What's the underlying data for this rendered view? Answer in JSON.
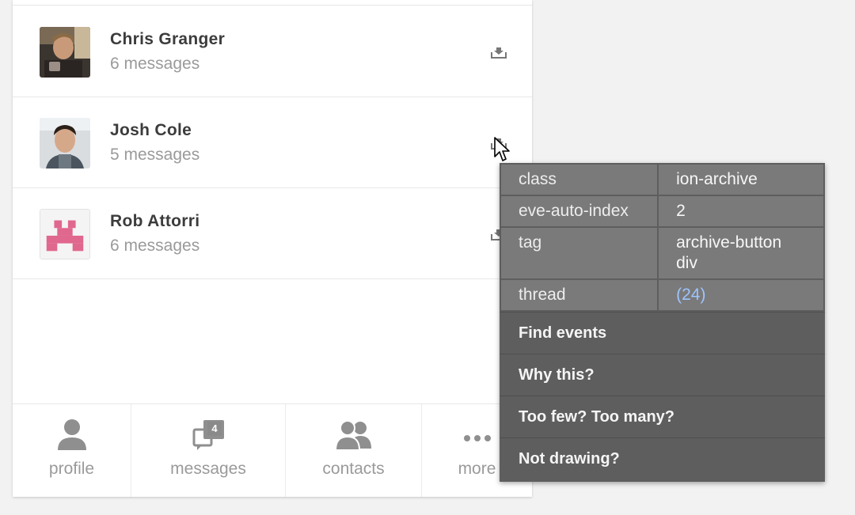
{
  "contacts": [
    {
      "name": "Chris Granger",
      "subtitle": "6 messages",
      "avatar": "photo-chris"
    },
    {
      "name": "Josh Cole",
      "subtitle": "5 messages",
      "avatar": "photo-josh"
    },
    {
      "name": "Rob Attorri",
      "subtitle": "6 messages",
      "avatar": "pink-logo"
    }
  ],
  "tabs": [
    {
      "label": "profile",
      "icon": "person-icon"
    },
    {
      "label": "messages",
      "icon": "chat-icon",
      "badge": "4"
    },
    {
      "label": "contacts",
      "icon": "people-icon"
    },
    {
      "label": "more",
      "icon": "ellipsis-icon"
    }
  ],
  "inspector": {
    "properties": [
      {
        "key": "class",
        "value": "ion-archive"
      },
      {
        "key": "eve-auto-index",
        "value": "2"
      },
      {
        "key": "tag",
        "value": "archive-button div"
      },
      {
        "key": "thread",
        "value": "(24)"
      }
    ],
    "menu": [
      "Find events",
      "Why this?",
      "Too few? Too many?",
      "Not drawing?"
    ]
  },
  "colors": {
    "accent_pink": "#e0678e",
    "inspector_bg": "#5e5e5e",
    "inspector_cell": "#7a7a7a",
    "link_blue": "#9ec4ff"
  }
}
